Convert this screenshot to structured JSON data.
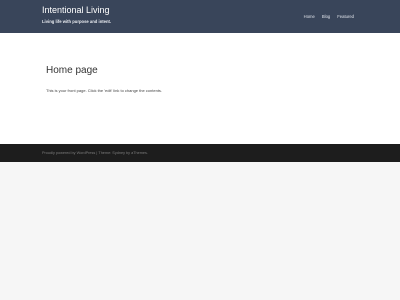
{
  "header": {
    "site_title": "Intentional Living",
    "tagline": "Living life with purpose and intent."
  },
  "nav": {
    "items": [
      {
        "label": "Home"
      },
      {
        "label": "Blog"
      },
      {
        "label": "Featured"
      }
    ]
  },
  "page": {
    "title": "Home page",
    "text_before": "This is your front page. Click the ",
    "edit_label": "'edit' link",
    "text_after": " to change the contents."
  },
  "footer": {
    "prefix": "Proudly powered by ",
    "wordpress_label": "WordPress",
    "separator": " | ",
    "theme_prefix": "Theme: Sydney by ",
    "theme_author_label": "aThemes",
    "suffix": "."
  },
  "colors": {
    "header_bg": "#39455a",
    "content_bg": "#ffffff",
    "footer_bg": "#1d1d1d",
    "page_bg": "#f6f6f6"
  }
}
